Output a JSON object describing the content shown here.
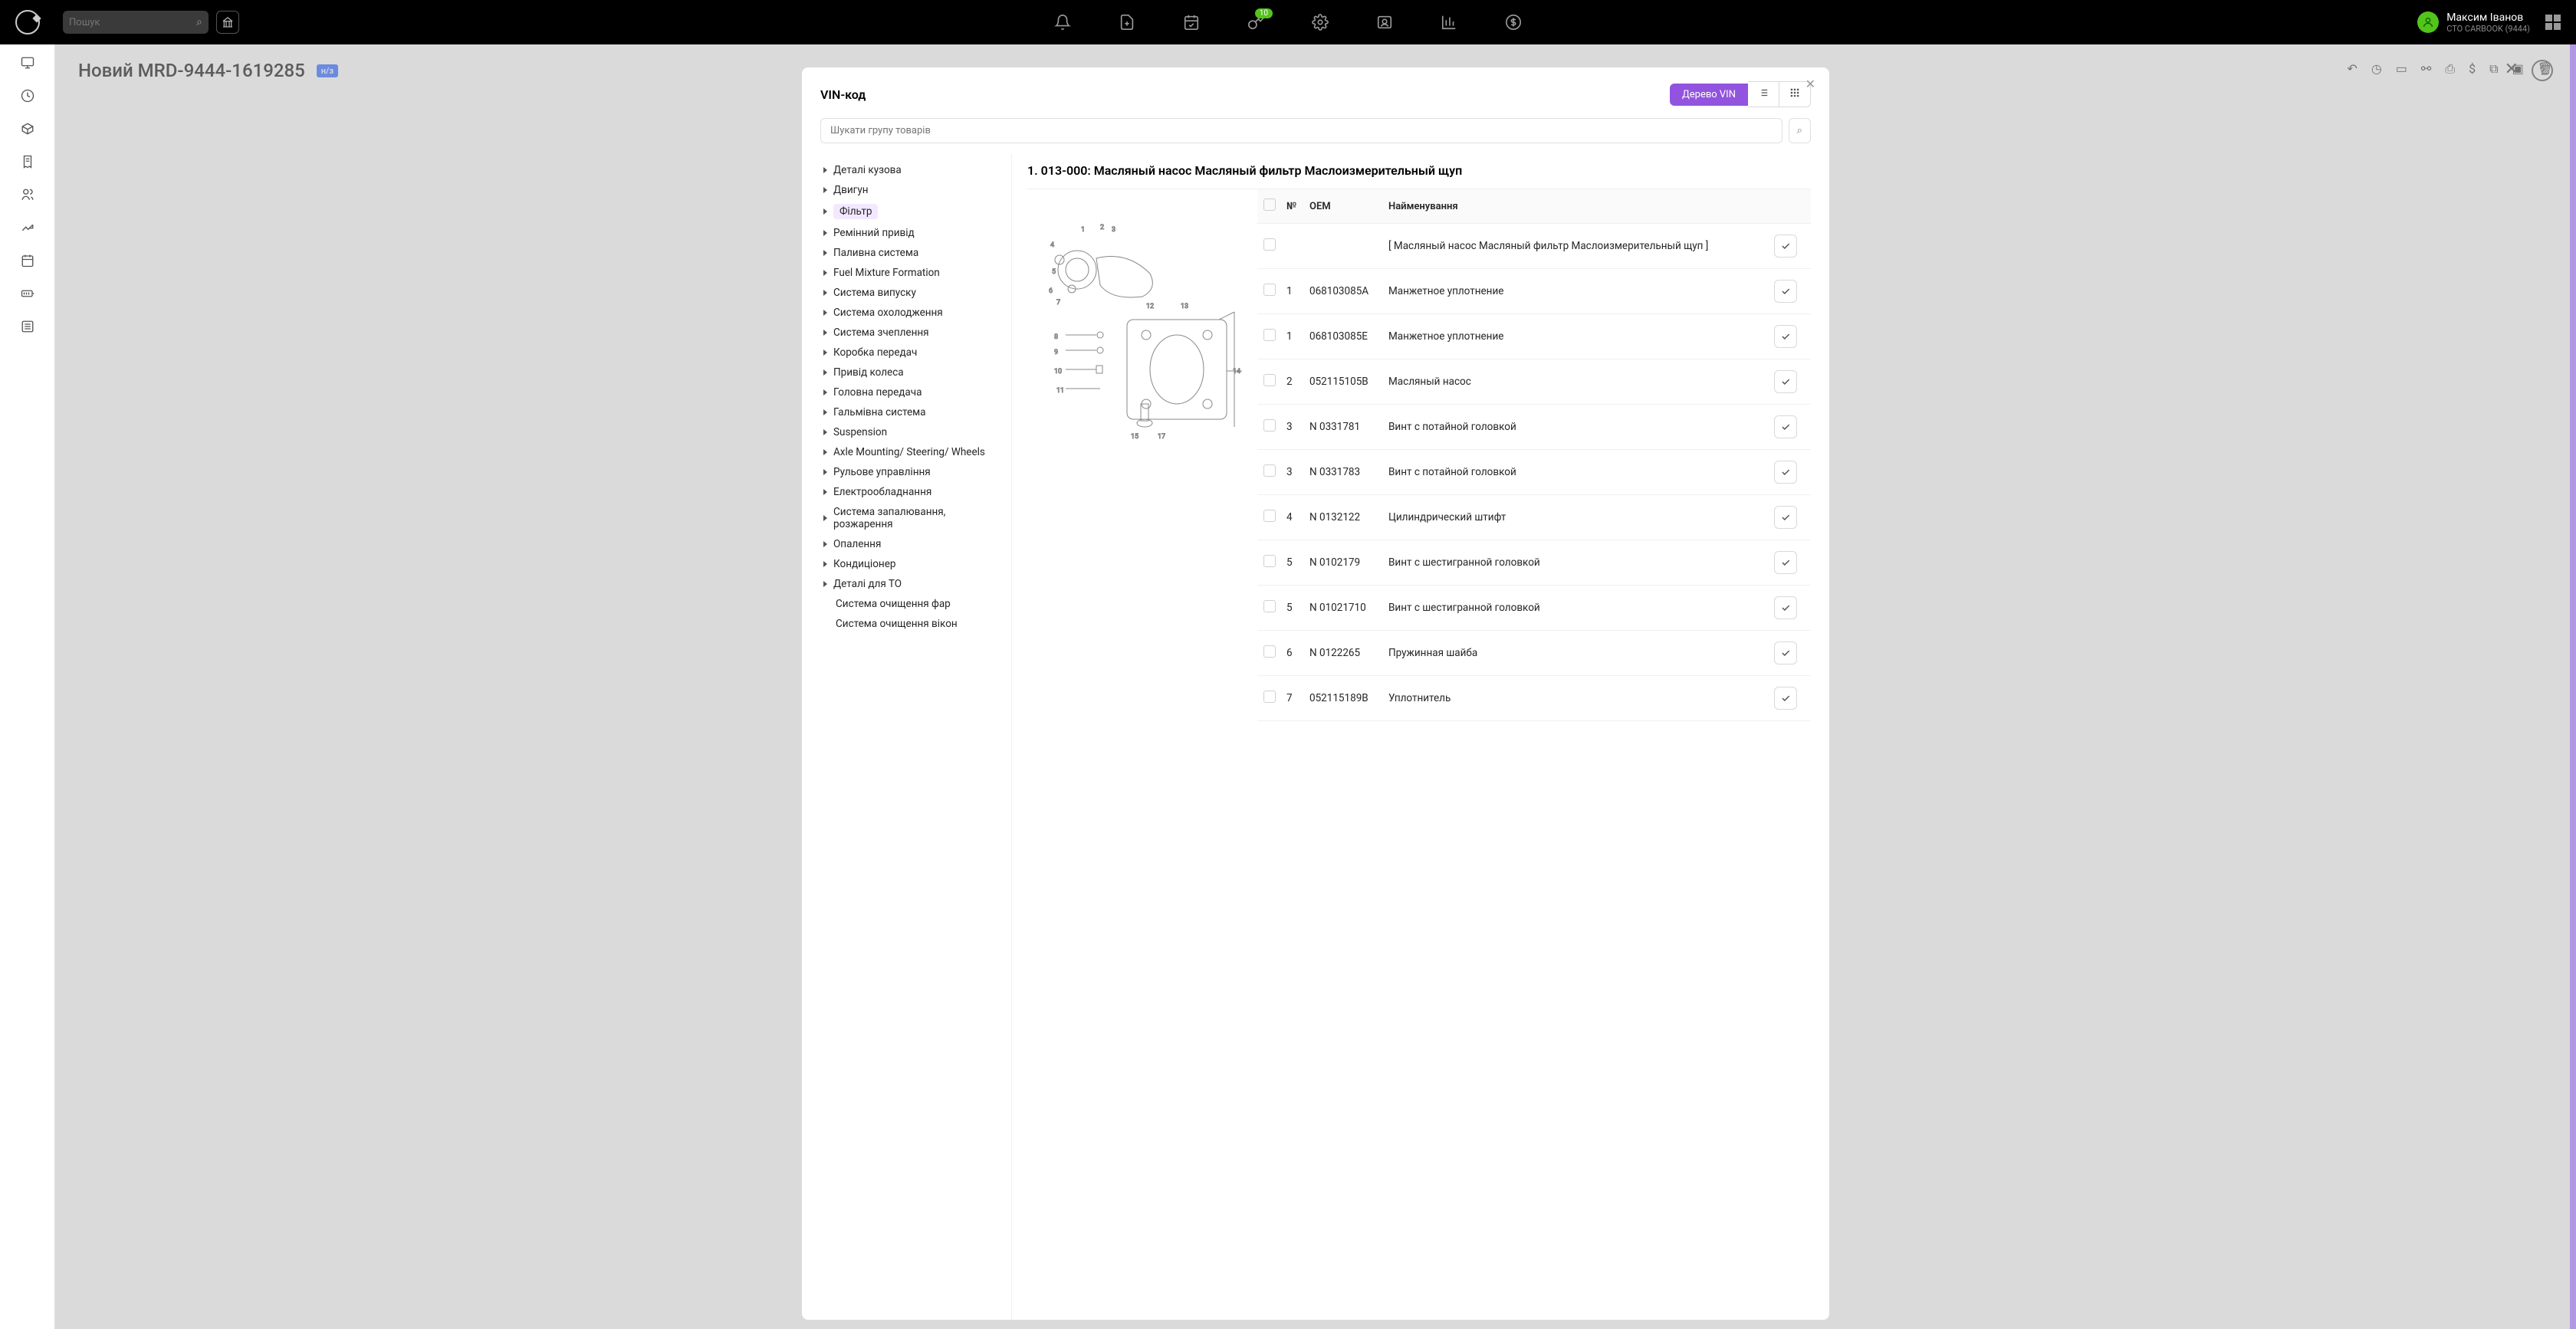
{
  "topbar": {
    "search_placeholder": "Пошук",
    "key_badge": "10",
    "user_name": "Максим Іванов",
    "user_sub": "СТО CARBOOK (9444)"
  },
  "page": {
    "title": "Новий MRD-9444-1619285",
    "tag": "н/з"
  },
  "modal": {
    "title": "VIN-код",
    "tree_btn": "Дерево VIN",
    "search_placeholder": "Шукати групу товарів",
    "parts_title": "1. 013-000: Масляный насос Масляный фильтр Маслоизмерительный щуп",
    "table_headers": {
      "num": "№",
      "oem": "OEM",
      "name": "Найменування"
    }
  },
  "tree": [
    {
      "label": "Деталі кузова",
      "caret": true
    },
    {
      "label": "Двигун",
      "caret": true
    },
    {
      "label": "Фільтр",
      "caret": true,
      "selected": true
    },
    {
      "label": "Ремінний привід",
      "caret": true
    },
    {
      "label": "Паливна система",
      "caret": true
    },
    {
      "label": "Fuel Mixture Formation",
      "caret": true
    },
    {
      "label": "Система випуску",
      "caret": true
    },
    {
      "label": "Система охолодження",
      "caret": true
    },
    {
      "label": "Система зчеплення",
      "caret": true
    },
    {
      "label": "Коробка передач",
      "caret": true
    },
    {
      "label": "Привід колеса",
      "caret": true
    },
    {
      "label": "Головна передача",
      "caret": true
    },
    {
      "label": "Гальмівна система",
      "caret": true
    },
    {
      "label": "Suspension",
      "caret": true
    },
    {
      "label": "Axle Mounting/ Steering/ Wheels",
      "caret": true
    },
    {
      "label": "Рульове управління",
      "caret": true
    },
    {
      "label": "Електрообладнання",
      "caret": true
    },
    {
      "label": "Система запалювання, розжарення",
      "caret": true
    },
    {
      "label": "Опалення",
      "caret": true
    },
    {
      "label": "Кондиціонер",
      "caret": true
    },
    {
      "label": "Деталі для ТО",
      "caret": true
    },
    {
      "label": "Система очищення фар",
      "caret": false
    },
    {
      "label": "Система очищення вікон",
      "caret": false
    }
  ],
  "parts": [
    {
      "num": "",
      "oem": "",
      "name": "[ Масляный насос Масляный фильтр Маслоизмерительный щуп ]"
    },
    {
      "num": "1",
      "oem": "068103085A",
      "name": "Манжетное уплотнение"
    },
    {
      "num": "1",
      "oem": "068103085E",
      "name": "Манжетное уплотнение"
    },
    {
      "num": "2",
      "oem": "052115105B",
      "name": "Масляный насос"
    },
    {
      "num": "3",
      "oem": "N 0331781",
      "name": "Винт с потайной головкой"
    },
    {
      "num": "3",
      "oem": "N 0331783",
      "name": "Винт с потайной головкой"
    },
    {
      "num": "4",
      "oem": "N 0132122",
      "name": "Цилиндрический штифт"
    },
    {
      "num": "5",
      "oem": "N 0102179",
      "name": "Винт с шестигранной головкой"
    },
    {
      "num": "5",
      "oem": "N 01021710",
      "name": "Винт с шестигранной головкой"
    },
    {
      "num": "6",
      "oem": "N 0122265",
      "name": "Пружинная шайба"
    },
    {
      "num": "7",
      "oem": "052115189B",
      "name": "Уплотнитель"
    }
  ]
}
